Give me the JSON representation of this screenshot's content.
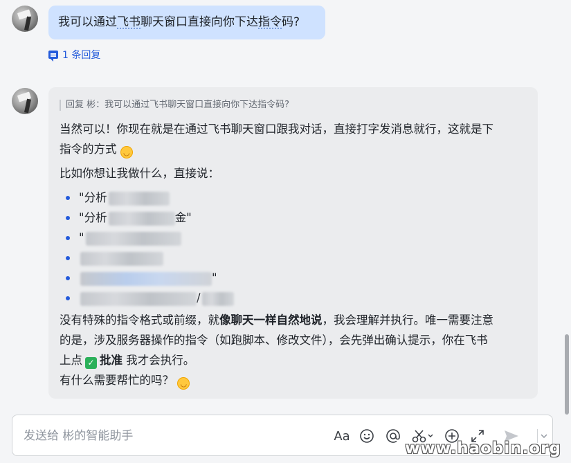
{
  "messages": {
    "user": {
      "text_before": "我可以通过",
      "text_highlight": "飞书",
      "text_mid": "聊天窗口直接向你下达",
      "text_highlight2": "指令",
      "text_after": "码?",
      "reply_count": "1 条回复"
    },
    "bot": {
      "quote": "回复 彬：我可以通过飞书聊天窗口直接向你下达指令码?",
      "p1_line1": "当然可以！你现在就是在通过飞书聊天窗口跟我对话，直接打字发消息就行，这就是下",
      "p1_line2": "指令的方式",
      "p2": "比如你想让我做什么，直接说：",
      "items": [
        {
          "text": "\"分析",
          "suffix": ""
        },
        {
          "text": "\"分析",
          "suffix": "金\""
        },
        {
          "text": "\"",
          "suffix": ""
        },
        {
          "text": "",
          "suffix": ""
        },
        {
          "text": "",
          "suffix": "\""
        },
        {
          "text": "",
          "suffix": "/"
        }
      ],
      "p3_line1_a": "没有特殊的指令格式或前缀，就",
      "p3_line1_bold": "像聊天一样自然地说",
      "p3_line1_b": "，我会理解并执行。唯一需要注意",
      "p3_line2": "的是，涉及服务器操作的指令（如跑脚本、修改文件），会先弹出确认提示，你在飞书",
      "p3_line3_a": "上点",
      "p3_line3_bold": "批准",
      "p3_line3_b": "我才会执行。",
      "p4": "有什么需要帮忙的吗？"
    }
  },
  "composer": {
    "placeholder": "发送给 彬的智能助手",
    "format_label": "Aa"
  },
  "icons": {
    "emoji": "smile-emoji-icon",
    "check": "check-mark-icon"
  },
  "watermark": "www.haobin.org"
}
